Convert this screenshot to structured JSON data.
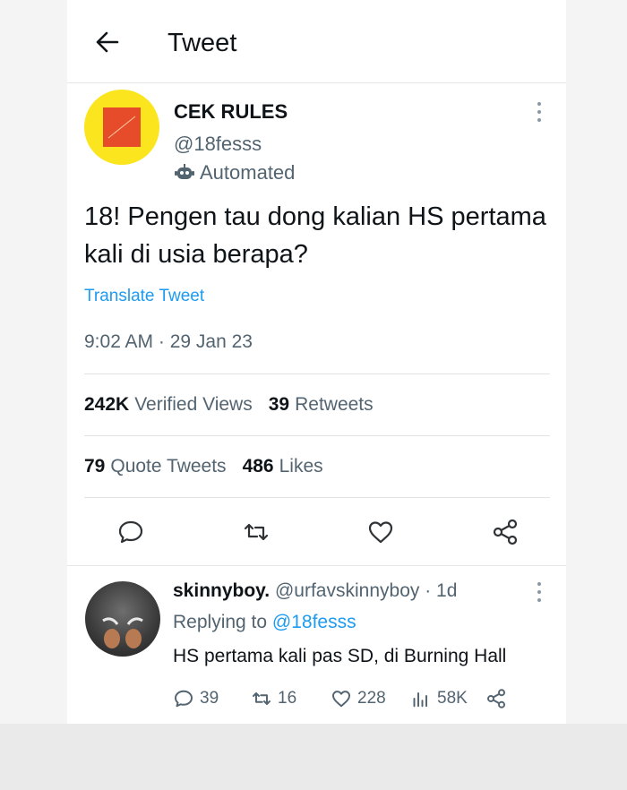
{
  "header": {
    "title": "Tweet",
    "back_icon": "arrow-left-icon"
  },
  "tweet": {
    "author_name": "CEK RULES",
    "author_handle": "@18fesss",
    "automated_label": "Automated",
    "text": "18! Pengen tau dong kalian HS pertama kali di usia berapa?",
    "translate_label": "Translate Tweet",
    "timestamp": "9:02 AM · 29 Jan 23",
    "stats": {
      "views_count": "242K",
      "views_label": "Verified Views",
      "retweets_count": "39",
      "retweets_label": "Retweets",
      "quotes_count": "79",
      "quotes_label": "Quote Tweets",
      "likes_count": "486",
      "likes_label": "Likes"
    },
    "actions": [
      "reply-icon",
      "retweet-icon",
      "like-icon",
      "share-icon"
    ]
  },
  "reply": {
    "name": "skinnyboy.",
    "handle_time": "@urfavskinnyboy · 1d",
    "replying_prefix": "Replying to",
    "replying_mention": "@18fesss",
    "text": "HS pertama kali pas SD, di Burning Hall",
    "reply_count": "39",
    "retweet_count": "16",
    "like_count": "228",
    "view_count": "58K"
  },
  "colors": {
    "accent": "#1d9bf0",
    "text": "#0f1419",
    "secondary": "#536471",
    "avatar_bg": "#fae51e"
  }
}
